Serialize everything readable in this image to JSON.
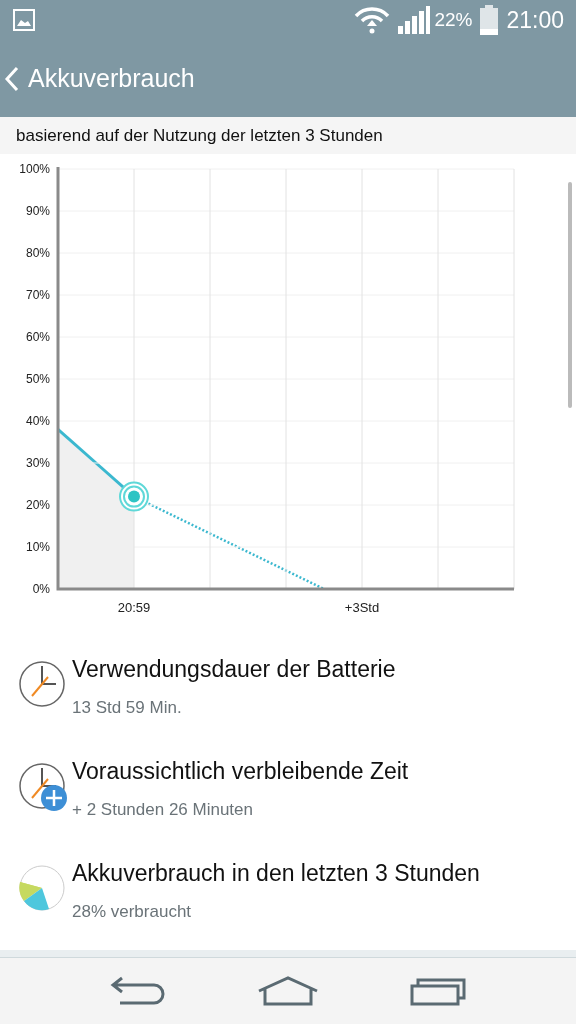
{
  "status_bar": {
    "battery_percent": "22%",
    "time": "21:00"
  },
  "app_bar": {
    "title": "Akkuverbrauch"
  },
  "subtitle": "basierend auf der Nutzung der letzten 3 Stunden",
  "chart": {
    "chart_data": {
      "type": "line",
      "categories": [
        null,
        null,
        "20:59",
        null,
        null,
        null,
        null,
        null,
        "+3Std",
        null,
        null,
        null,
        null
      ],
      "ylim": [
        0,
        100
      ],
      "grid": true,
      "yticks": [
        {
          "value": 0,
          "label": "0%"
        },
        {
          "value": 10,
          "label": "10%"
        },
        {
          "value": 20,
          "label": "20%"
        },
        {
          "value": 30,
          "label": "30%"
        },
        {
          "value": 40,
          "label": "40%"
        },
        {
          "value": 50,
          "label": "50%"
        },
        {
          "value": 60,
          "label": "60%"
        },
        {
          "value": 70,
          "label": "70%"
        },
        {
          "value": 80,
          "label": "80%"
        },
        {
          "value": 90,
          "label": "90%"
        },
        {
          "value": 100,
          "label": "100%"
        }
      ],
      "series": [
        {
          "color": "#3bb8cf",
          "line_style": "solid",
          "values": [
            38,
            30,
            22,
            null,
            null,
            null,
            null,
            null,
            null,
            null,
            null,
            null,
            null
          ]
        },
        {
          "color": "#3bb8cf",
          "line_style": "dashed",
          "values": [
            null,
            null,
            22,
            17.6,
            13.2,
            8.8,
            4.4,
            0,
            null,
            null,
            null,
            null,
            null
          ]
        }
      ]
    }
  },
  "items": [
    {
      "kind": "clock",
      "title": "Verwendungsdauer der Batterie",
      "value": "13 Std 59 Min."
    },
    {
      "kind": "clock-plus",
      "title": "Voraussichtlich verbleibende Zeit",
      "value": "+ 2 Stunden 26 Minuten"
    },
    {
      "kind": "pie",
      "title": "Akkuverbrauch in den letzten 3 Stunden",
      "value": "28% verbraucht"
    }
  ]
}
